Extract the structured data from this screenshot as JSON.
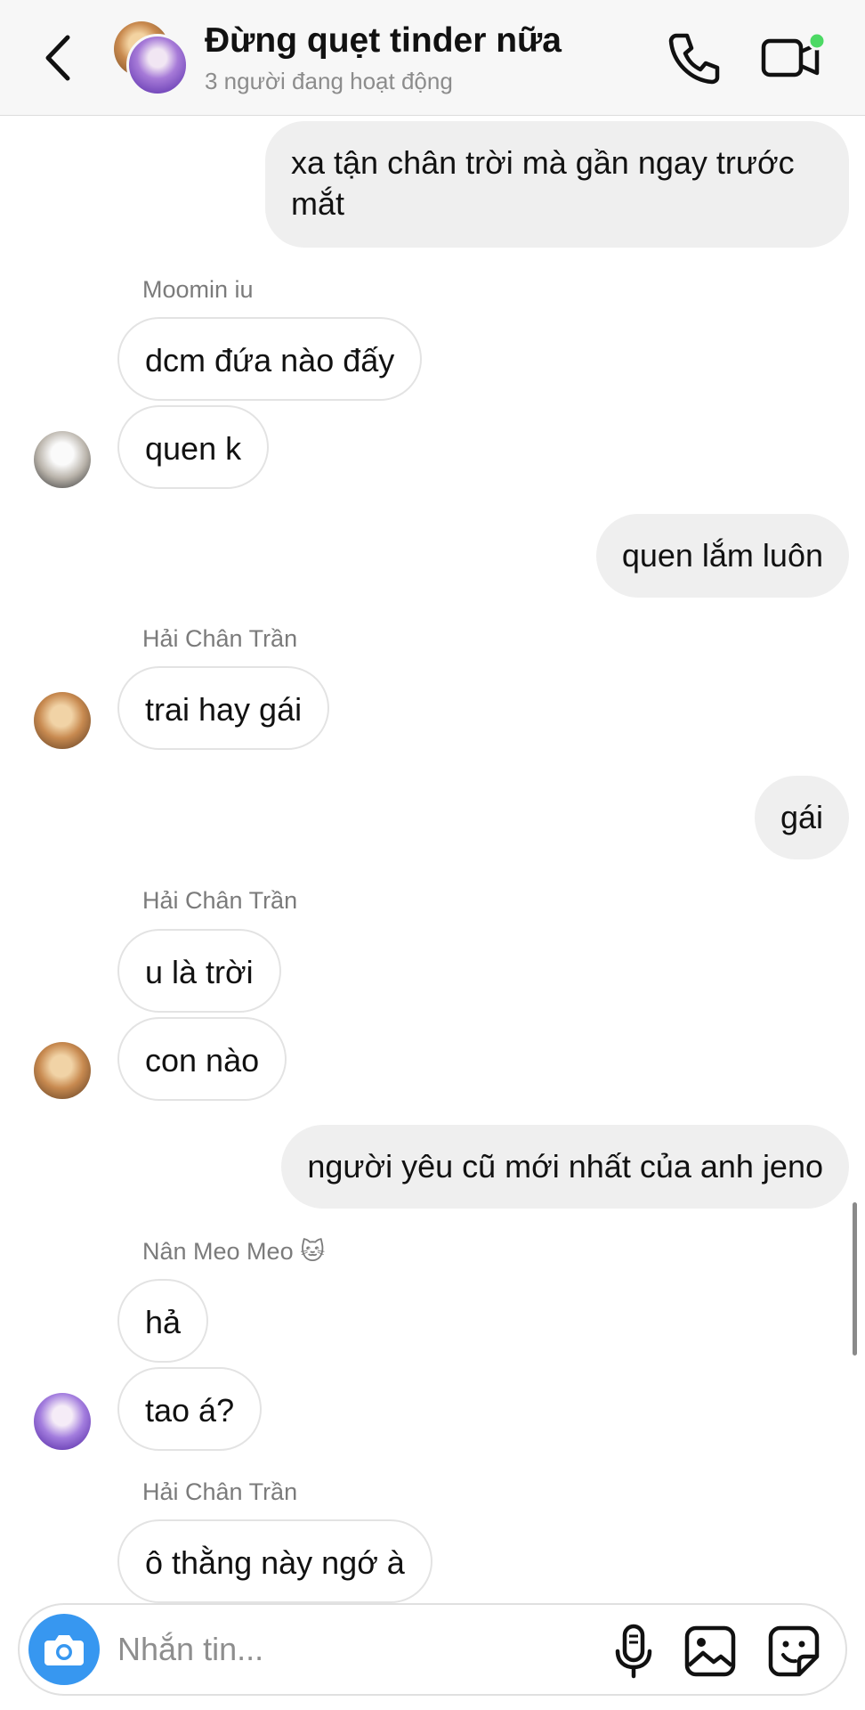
{
  "header": {
    "title": "Đừng quẹt tinder nữa",
    "status": "3 người đang hoạt động",
    "icons": {
      "back": "chevron-left-icon",
      "call": "phone-icon",
      "video": "video-camera-icon"
    },
    "active_dot_color": "#4cd964"
  },
  "messages": [
    {
      "type": "outgoing",
      "text": "xa tận chân trời mà gần ngay trước mắt"
    },
    {
      "type": "incoming",
      "sender": "Moomin iu",
      "texts": [
        "dcm đứa nào đấy",
        "quen k"
      ]
    },
    {
      "type": "outgoing",
      "text": "quen lắm luôn"
    },
    {
      "type": "incoming",
      "sender": "Hải Chân Trần",
      "texts": [
        "trai hay gái"
      ]
    },
    {
      "type": "outgoing",
      "text": "gái"
    },
    {
      "type": "incoming",
      "sender": "Hải Chân Trần",
      "texts": [
        "u là trời",
        "con nào"
      ]
    },
    {
      "type": "outgoing",
      "text": "người yêu cũ mới nhất của anh jeno"
    },
    {
      "type": "incoming",
      "sender": "Nân Meo Meo",
      "sender_emoji": "🐱",
      "texts": [
        "hả",
        "tao á?"
      ]
    },
    {
      "type": "incoming",
      "sender": "Hải Chân Trần",
      "texts": [
        "ô thằng này ngớ à"
      ]
    }
  ],
  "composer": {
    "placeholder": "Nhắn tin...",
    "icons": {
      "camera": "camera-icon",
      "mic": "microphone-icon",
      "gallery": "gallery-icon",
      "sticker": "sticker-icon"
    },
    "accent_color": "#3797f0"
  },
  "colors": {
    "outgoing_bubble": "#efefef",
    "incoming_border": "#e3e3e3",
    "sender_text": "#7b7b7b"
  }
}
